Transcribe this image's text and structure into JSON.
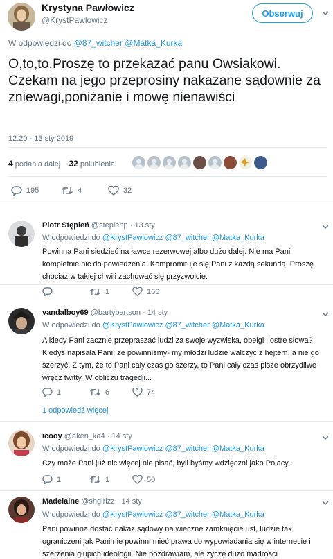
{
  "main": {
    "author_name": "Krystyna Pawłowicz",
    "author_handle": "@KrystPawlowicz",
    "follow_label": "Obserwuj",
    "reply_prefix": "W odpowiedzi do",
    "reply_mention_1": "@87_witcher",
    "reply_mention_2": "@Matka_Kurka",
    "text": "O,to,to.Proszę to przekazać panu Owsiakowi. Czekam na jego przeprosiny nakazane sądownie za zniewagi,poniżanie i mowę nienawiści",
    "timestamp": "12:20 - 13 sty 2019",
    "retweets_count": "4",
    "retweets_label": "podania dalej",
    "likes_count": "32",
    "likes_label": "polubienia",
    "actions": {
      "replies": "195",
      "retweets": "4",
      "likes": "32"
    }
  },
  "replies": [
    {
      "name": "Piotr Stępień",
      "handle": "@stepienp",
      "date": "13 sty",
      "reply_prefix": "W odpowiedzi do",
      "mentions": "@KrystPawlowicz @87_witcher @Matka_Kurka",
      "text": "Powinna Pani siedzieć na ławce rezerwowej albo dużo dalej. Nie ma Pani kompletnie nic do powiedzenia. Kompromituje się Pani z każdą sekundą. Proszę chociaż w takiej chwili zachować się przyzwoicie.",
      "replies": "",
      "retweets": "1",
      "likes": "166"
    },
    {
      "name": "vandalboy69",
      "handle": "@bartybartson",
      "date": "14 sty",
      "reply_prefix": "W odpowiedzi do",
      "mentions": "@KrystPawlowicz @87_witcher @Matka_Kurka",
      "text": "A kiedy Pani zacznie przepraszać ludzi za swoje wyzwiska, obelgi i ostre słowa? Kiedyś napisała  Pani, że powinnismy- my młodzi ludzie walczyć z hejtem, a nie go szerzyć. Z tym, że to Pani cały czas go szerzy, to Pani cały czas pisze obrzydliwe wręcz twitty. W obliczu tragedii...",
      "replies": "1",
      "retweets": "6",
      "likes": "74",
      "more": "1 odpowiedź więcej"
    },
    {
      "name": "icooy",
      "handle": "@aken_ka4",
      "date": "14 sty",
      "reply_prefix": "W odpowiedzi do",
      "mentions": "@KrystPawlowicz @87_witcher @Matka_Kurka",
      "text": "Czy może Pani już nic więcej nie pisać, byli byśmy wdzięczni jako Polacy.",
      "replies": "1",
      "retweets": "1",
      "likes": "50"
    },
    {
      "name": "Madelaine",
      "handle": "@shgirlzz",
      "date": "14 sty",
      "reply_prefix": "W odpowiedzi do",
      "mentions": "@KrystPawlowicz @87_witcher @Matka_Kurka",
      "text": "Pani powinna dostać nakaz sądowy na wieczne zamknięcie ust, ludzie tak ograniczeni jak Pani nie powinni mieć prawa do wypowiadania się w internecie i szerzenia głupich ideologii. Nie pozdrawiam, ale życzę dużo madrosci"
    }
  ],
  "icons": [
    "reply-icon",
    "retweet-icon",
    "heart-icon",
    "chevron-down-icon"
  ],
  "colors": {
    "link": "#1b95e0",
    "muted": "#657786",
    "accent": "#1da1f2",
    "text": "#14171a"
  }
}
